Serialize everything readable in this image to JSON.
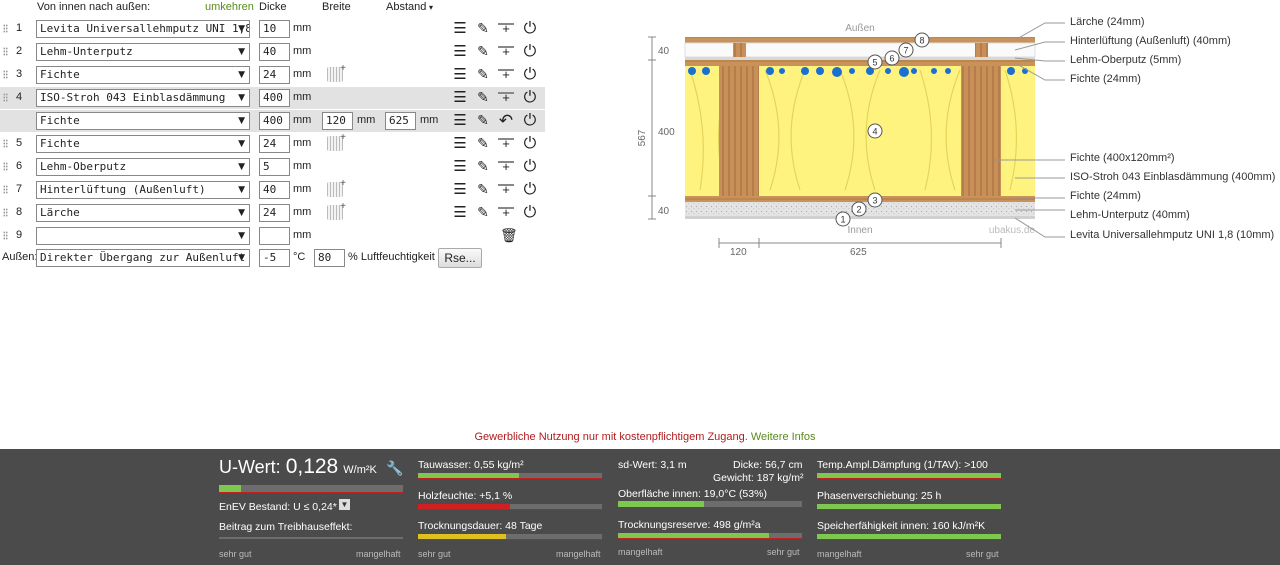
{
  "header": {
    "order_label": "Von innen nach außen:",
    "reverse_label": "umkehren",
    "thickness_label": "Dicke",
    "width_label": "Breite",
    "spacing_label": "Abstand",
    "spacing_arrow": "▾"
  },
  "layers": [
    {
      "num": "1",
      "material": "Levita Universallehmputz UNI 1,8",
      "thickness": "10",
      "unit": "mm",
      "has_wood_button": false
    },
    {
      "num": "2",
      "material": "Lehm-Unterputz",
      "thickness": "40",
      "unit": "mm",
      "has_wood_button": false
    },
    {
      "num": "3",
      "material": "Fichte",
      "thickness": "24",
      "unit": "mm",
      "has_wood_button": true
    },
    {
      "num": "4",
      "material": "ISO-Stroh 043 Einblasdämmung",
      "thickness": "400",
      "unit": "mm",
      "has_wood_button": false,
      "sub": {
        "material": "Fichte",
        "thickness": "400",
        "width": "120",
        "spacing": "625",
        "unit": "mm"
      }
    },
    {
      "num": "5",
      "material": "Fichte",
      "thickness": "24",
      "unit": "mm",
      "has_wood_button": true
    },
    {
      "num": "6",
      "material": "Lehm-Oberputz",
      "thickness": "5",
      "unit": "mm",
      "has_wood_button": false
    },
    {
      "num": "7",
      "material": "Hinterlüftung (Außenluft)",
      "thickness": "40",
      "unit": "mm",
      "has_wood_button": true
    },
    {
      "num": "8",
      "material": "Lärche",
      "thickness": "24",
      "unit": "mm",
      "has_wood_button": true
    },
    {
      "num": "9",
      "material": "",
      "thickness": "",
      "unit": "mm",
      "has_wood_button": false
    }
  ],
  "outside": {
    "label": "Außen:",
    "material": "Direkter Übergang zur Außenluft",
    "temperature": "-5",
    "temp_unit": "°C",
    "humidity": "80",
    "humidity_label": "% Luftfeuchtigkeit",
    "rse_button": "Rse..."
  },
  "drawing": {
    "top_label": "Außen",
    "bottom_label": "Innen",
    "watermark": "ubakus.de",
    "dim_total": "567",
    "dim_top": "40",
    "dim_mid": "400",
    "dim_bottom": "40",
    "dim_width": "120",
    "dim_spacing": "625",
    "markers": [
      "1",
      "2",
      "3",
      "4",
      "5",
      "6",
      "7",
      "8"
    ],
    "legend_top": [
      "Lärche (24mm)",
      "Hinterlüftung (Außenluft) (40mm)",
      "Lehm-Oberputz (5mm)",
      "Fichte (24mm)"
    ],
    "legend_bottom": [
      "Fichte (400x120mm²)",
      "ISO-Stroh 043 Einblasdämmung (400mm)",
      "Fichte (24mm)",
      "Lehm-Unterputz (40mm)",
      "Levita Universallehmputz UNI 1,8 (10mm)"
    ]
  },
  "notice": {
    "text": "Gewerbliche Nutzung nur mit kostenpflichtigem Zugang.",
    "link": "Weitere Infos"
  },
  "results": {
    "uwert_label": "U-Wert:",
    "uwert_value": "0,128",
    "uwert_unit": "W/m²K",
    "enev": "EnEV Bestand: U ≤ 0,24*",
    "greenhouse": "Beitrag zum Treibhauseffekt:",
    "scale_good": "sehr gut",
    "scale_bad": "mangelhaft",
    "tauwasser": "Tauwasser: 0,55 kg/m²",
    "holzfeuchte": "Holzfeuchte: +5,1 %",
    "trocknungsdauer": "Trocknungsdauer: 48 Tage",
    "sd_wert": "sd-Wert: 3,1 m",
    "dicke": "Dicke: 56,7 cm",
    "gewicht": "Gewicht: 187 kg/m²",
    "oberflaeche": "Oberfläche innen: 19,0°C (53%)",
    "trocknungsreserve": "Trocknungsreserve: 498 g/m²a",
    "temp_ampl": "Temp.Ampl.Dämpfung (1/TAV): >100",
    "phasen": "Phasenverschiebung: 25 h",
    "speicher": "Speicherfähigkeit innen: 160 kJ/m²K",
    "uwert_fill": 0.12,
    "tauwasser_fill": 0.55,
    "holzfeuchte_fill": 0.5,
    "trocknungsdauer_fill": 0.48,
    "oberflaeche_fill": 0.47,
    "trocknungsreserve_fill": 0.82,
    "temp_ampl_fill": 1.0,
    "phasen_fill": 1.0,
    "speicher_fill": 1.0,
    "color_good": "#7ec850",
    "color_warn": "#e0c020",
    "color_bad": "#d02020"
  }
}
